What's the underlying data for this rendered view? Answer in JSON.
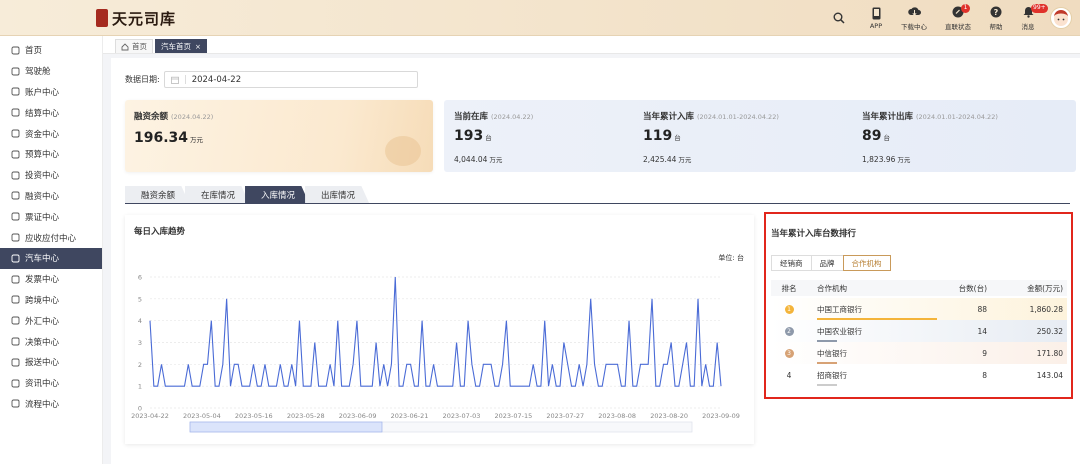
{
  "app": {
    "title": "天元司库"
  },
  "top_actions": {
    "app": "APP",
    "download": "下载中心",
    "direct_link": "直联状态",
    "direct_link_badge": "1",
    "help": "帮助",
    "messages": "消息",
    "messages_badge": "99+"
  },
  "sidebar": {
    "items": [
      {
        "label": "首页",
        "icon": "home-icon"
      },
      {
        "label": "驾驶舱",
        "icon": "dashboard-icon"
      },
      {
        "label": "账户中心",
        "icon": "account-icon"
      },
      {
        "label": "结算中心",
        "icon": "settlement-icon"
      },
      {
        "label": "资金中心",
        "icon": "funds-icon"
      },
      {
        "label": "预算中心",
        "icon": "budget-icon"
      },
      {
        "label": "投资中心",
        "icon": "investment-icon"
      },
      {
        "label": "融资中心",
        "icon": "financing-icon"
      },
      {
        "label": "票证中心",
        "icon": "ticket-icon"
      },
      {
        "label": "应收应付中心",
        "icon": "receivable-icon"
      },
      {
        "label": "汽车中心",
        "icon": "car-icon",
        "active": true
      },
      {
        "label": "发票中心",
        "icon": "invoice-icon"
      },
      {
        "label": "跨境中心",
        "icon": "crossborder-icon"
      },
      {
        "label": "外汇中心",
        "icon": "forex-icon"
      },
      {
        "label": "决策中心",
        "icon": "decision-icon"
      },
      {
        "label": "报送中心",
        "icon": "report-icon"
      },
      {
        "label": "资讯中心",
        "icon": "news-icon"
      },
      {
        "label": "流程中心",
        "icon": "workflow-icon"
      }
    ]
  },
  "page_tabs": {
    "home": "首页",
    "car_home": "汽车首页"
  },
  "filter": {
    "date_label": "数据日期:",
    "date_value": "2024-04-22"
  },
  "financing": {
    "title": "融资余额",
    "date": "(2024.04.22)",
    "value": "196.34",
    "unit": "万元"
  },
  "stats": [
    {
      "title": "当前在库",
      "date": "(2024.04.22)",
      "count": "193",
      "count_unit": "台",
      "amount": "4,044.04",
      "amount_unit": "万元"
    },
    {
      "title": "当年累计入库",
      "date": "(2024.01.01-2024.04.22)",
      "count": "119",
      "count_unit": "台",
      "amount": "2,425.44",
      "amount_unit": "万元"
    },
    {
      "title": "当年累计出库",
      "date": "(2024.01.01-2024.04.22)",
      "count": "89",
      "count_unit": "台",
      "amount": "1,823.96",
      "amount_unit": "万元"
    }
  ],
  "section_tabs": [
    "融资余额",
    "在库情况",
    "入库情况",
    "出库情况"
  ],
  "section_tab_active": 2,
  "trend": {
    "title": "每日入库趋势",
    "unit_label": "单位: 台"
  },
  "chart_data": {
    "type": "line",
    "title": "每日入库趋势",
    "ylim": [
      0,
      6
    ],
    "y_ticks": [
      0,
      1,
      2,
      3,
      4,
      5,
      6
    ],
    "x_tick_labels": [
      "2023-04-22",
      "2023-05-04",
      "2023-05-16",
      "2023-05-28",
      "2023-06-09",
      "2023-06-21",
      "2023-07-03",
      "2023-07-15",
      "2023-07-27",
      "2023-08-08",
      "2023-08-20",
      "2023-09-09"
    ],
    "series": [
      {
        "values": [
          4,
          1,
          1,
          2,
          1,
          1,
          1,
          1,
          1,
          1,
          2,
          1,
          1,
          1,
          2,
          2,
          4,
          1,
          1,
          2,
          5,
          1,
          2,
          2,
          1,
          1,
          1,
          2,
          1,
          1,
          2,
          1,
          1,
          1,
          2,
          1,
          1,
          2,
          1,
          4,
          1,
          1,
          1,
          3,
          1,
          1,
          1,
          2,
          1,
          4,
          1,
          1,
          1,
          2,
          4,
          1,
          1,
          1,
          1,
          3,
          1,
          2,
          1,
          2,
          6,
          1,
          1,
          2,
          2,
          1,
          1,
          4,
          1,
          1,
          2,
          1,
          1,
          1,
          1,
          1,
          3,
          1,
          1,
          4,
          2,
          1,
          1,
          2,
          2,
          2,
          1,
          1,
          2,
          4,
          1,
          1,
          1,
          1,
          1,
          1,
          2,
          1,
          1,
          4,
          1,
          2,
          1,
          1,
          3,
          2,
          1,
          1,
          2,
          1,
          2,
          5,
          2,
          1,
          1,
          2,
          2,
          2,
          2,
          1,
          1,
          4,
          1,
          1,
          2,
          2,
          2,
          5,
          1,
          1,
          2,
          2,
          3,
          1,
          1,
          2,
          3,
          1,
          1,
          5,
          1,
          2,
          1,
          1,
          3,
          1
        ]
      }
    ]
  },
  "ranking": {
    "title": "当年累计入库台数排行",
    "tabs": [
      "经销商",
      "品牌",
      "合作机构"
    ],
    "active_tab": 2,
    "headers": {
      "rank": "排名",
      "org": "合作机构",
      "count": "台数(台)",
      "amount": "金额(万元)"
    },
    "rows": [
      {
        "rank": "1",
        "org": "中国工商银行",
        "count": "88",
        "amount": "1,860.28",
        "color": "#f4b43a",
        "bg": "#fdf3dc"
      },
      {
        "rank": "2",
        "org": "中国农业银行",
        "count": "14",
        "amount": "250.32",
        "color": "#8e99aa",
        "bg": "#e7ecf3"
      },
      {
        "rank": "3",
        "org": "中信银行",
        "count": "9",
        "amount": "171.80",
        "color": "#d7a275",
        "bg": "#fbf0e8"
      },
      {
        "rank": "4",
        "org": "招商银行",
        "count": "8",
        "amount": "143.04",
        "color": "",
        "bg": "#ffffff"
      }
    ]
  }
}
